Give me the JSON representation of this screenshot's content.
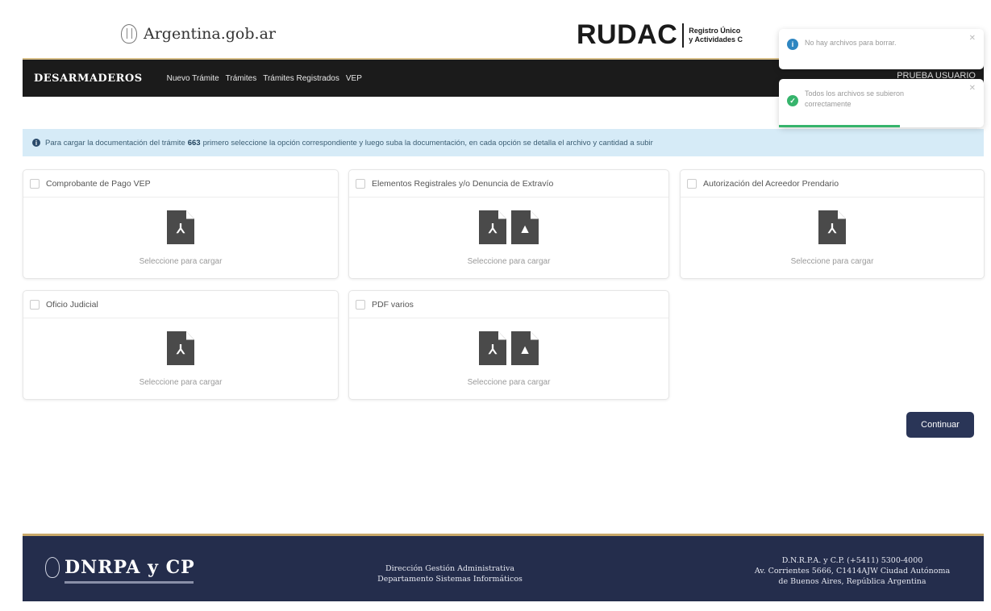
{
  "header": {
    "gob_logo_text": "Argentina.gob.ar",
    "rudac_title": "RUDAC",
    "rudac_subtitle_line1": "Registro Único",
    "rudac_subtitle_line2": "y Actividades C"
  },
  "navbar": {
    "brand": "DESARMADEROS",
    "links": [
      "Nuevo Trámite",
      "Trámites",
      "Trámites Registrados",
      "VEP"
    ],
    "user": "PRUEBA USUARIO"
  },
  "alert": {
    "text_before": "Para cargar la documentación del trámite",
    "tramite_number": "663",
    "text_after": "primero seleccione la opción correspondiente y luego suba la documentación, en cada opción se detalla el archivo y cantidad a subir"
  },
  "cards": [
    {
      "title": "Comprobante de Pago VEP",
      "subtitle": "Seleccione para cargar",
      "icons": [
        "pdf-icon"
      ]
    },
    {
      "title": "Elementos Registrales y/o Denuncia de Extravío",
      "subtitle": "Seleccione para cargar",
      "icons": [
        "pdf-icon",
        "image-file-icon"
      ]
    },
    {
      "title": "Autorización del Acreedor Prendario",
      "subtitle": "Seleccione para cargar",
      "icons": [
        "pdf-icon"
      ]
    },
    {
      "title": "Oficio Judicial",
      "subtitle": "Seleccione para cargar",
      "icons": [
        "pdf-icon"
      ]
    },
    {
      "title": "PDF varios",
      "subtitle": "Seleccione para cargar",
      "icons": [
        "pdf-icon",
        "image-file-icon"
      ]
    }
  ],
  "continue_button": "Continuar",
  "footer": {
    "logo_text": "DNRPA y CP",
    "middle_line1": "Dirección Gestión Administrativa",
    "middle_line2": "Departamento Sistemas Informáticos",
    "right_line1": "D.N.R.P.A. y C.P. (+5411) 5300-4000",
    "right_line2": "Av. Corrientes 5666, C1414AJW Ciudad Autónoma",
    "right_line3": "de Buenos Aires, República Argentina"
  },
  "toasts": [
    {
      "type": "info",
      "message": "No hay archivos para borrar.",
      "color": "#2e86c1"
    },
    {
      "type": "success",
      "message": "Todos los archivos se subieron correctamente",
      "color": "#36b46c"
    }
  ],
  "colors": {
    "navbar": "#1b1b1b",
    "footer": "#242d4c",
    "button": "#2a3557",
    "alert_bg": "#d6ebf7"
  }
}
